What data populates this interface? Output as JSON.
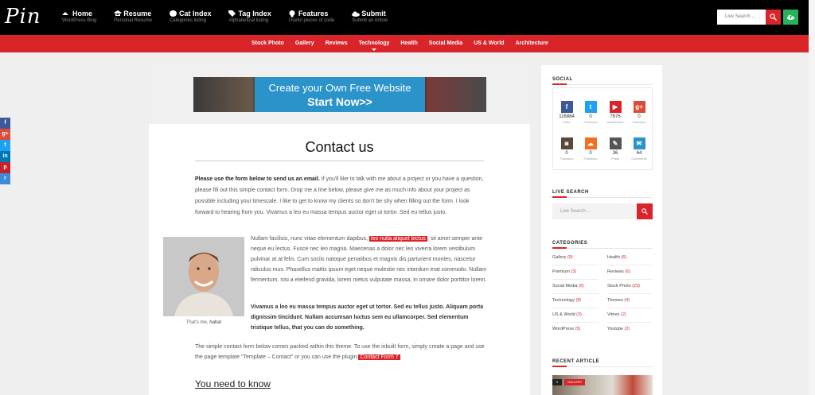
{
  "logo": "Pin",
  "nav": [
    {
      "title": "Home",
      "sub": "WordPress Blog",
      "icon": "home-icon"
    },
    {
      "title": "Resume",
      "sub": "Personal Resume",
      "icon": "graduation-cap-icon"
    },
    {
      "title": "Cat Index",
      "sub": "Categories listing",
      "icon": "globe-icon"
    },
    {
      "title": "Tag Index",
      "sub": "Alphabetical listing",
      "icon": "tags-icon"
    },
    {
      "title": "Features",
      "sub": "Useful pieces of code",
      "icon": "lightbulb-icon"
    },
    {
      "title": "Submit",
      "sub": "Submit an Article",
      "icon": "cloud-upload-icon"
    }
  ],
  "search": {
    "placeholder": "Live Search ..."
  },
  "categories_nav": [
    "Stock Photo",
    "Gallery",
    "Reviews",
    "Technology",
    "Health",
    "Social Media",
    "US & World",
    "Architecture"
  ],
  "social_side": [
    {
      "label": "f",
      "color": "#3b5998",
      "icon": "facebook-icon"
    },
    {
      "label": "g+",
      "color": "#dd4b39",
      "icon": "google-plus-icon"
    },
    {
      "label": "t",
      "color": "#1da1f2",
      "icon": "twitter-icon"
    },
    {
      "label": "in",
      "color": "#0077b5",
      "icon": "linkedin-icon"
    },
    {
      "label": "p",
      "color": "#cb2027",
      "icon": "pinterest-icon"
    },
    {
      "label": "r",
      "color": "#3d8ad8",
      "icon": "reddit-icon"
    }
  ],
  "banner": {
    "line1": "Create your Own Free Website",
    "line2": "Start Now>>"
  },
  "page": {
    "title": "Contact us",
    "intro_bold": "Please use the form below to send us an email.",
    "intro_rest": " If you'll like to talk with me about a project or you have a question, please fill out this simple contact form. Drop me a line below, please give me as much info about your project as possible including your timescale. I like to get to know my clients so don't be shy when filling out the form. I look forward to hearing from you. Vivamus a leo eu massa tempus auctor eget ut tortor. Sed eu tellus justo.",
    "para2_a": "Nullam facilisis, nunc vitae elementum dapibus, ",
    "para2_hl": "leo nulla aliquet lectus",
    "para2_b": ", sit amet semper ante neque eu lectus. Fusce nec leo magna. Maecenas a dolor nec leo viverra lorem vestibulum pulvinar at at felis. Cum sociis natoque penatibus et magnis dis parturient montes, nascetur ridiculus mus. Phasellus mattis ipsum eget neque molestie nec interdum erat commodo. Nullam fermentum, nisi a eleifend gravida, lorem metus vulputate massa, in ornare dolor porttitor lorem.",
    "para3": "Vivamus a leo eu massa tempus auctor eget ut tortor. Sed eu tellus justo. Aliquam porta dignissim tincidunt. Nullam accumsan luctus sem eu ullamcorper. Sed elementum tristique tellus, that you can do something.",
    "para4_a": "The simple contact form below comes packed within this theme. To use the inbuilt form, simply create a page and use the page template \"Template – Contact\" or you can use the plugin ",
    "para4_hl": "Contact Form 7",
    "para4_b": ".",
    "caption_a": "That's me, ",
    "caption_b": "haha!",
    "subhead": "You need to know"
  },
  "sidebar": {
    "social_title": "SOCIAL",
    "social": [
      {
        "num": "116884",
        "label": "Likes",
        "color": "#3b5998",
        "glyph": "f",
        "icon": "facebook-icon"
      },
      {
        "num": "0",
        "label": "Followers",
        "color": "#1da1f2",
        "glyph": "t",
        "icon": "twitter-icon"
      },
      {
        "num": "7676",
        "label": "Subscribers",
        "color": "#d9252a",
        "glyph": "▶",
        "icon": "youtube-icon"
      },
      {
        "num": "0",
        "label": "Followers",
        "color": "#dd4b39",
        "glyph": "g+",
        "icon": "google-plus-icon"
      },
      {
        "num": "0",
        "label": "Followers",
        "color": "#5b4638",
        "glyph": "◙",
        "icon": "instagram-icon"
      },
      {
        "num": "0",
        "label": "Followers",
        "color": "#f26f21",
        "glyph": "☁",
        "icon": "soundcloud-icon"
      },
      {
        "num": "36",
        "label": "Posts",
        "color": "#555555",
        "glyph": "✎",
        "icon": "pencil-icon"
      },
      {
        "num": "64",
        "label": "Comments",
        "color": "#2a93c9",
        "glyph": "✉",
        "icon": "comments-icon"
      }
    ],
    "live_search_title": "LIVE SEARCH",
    "live_search_placeholder": "Live Search ...",
    "categories_title": "CATEGORIES",
    "categories": [
      {
        "name": "Gallery",
        "count": "(9)"
      },
      {
        "name": "Health",
        "count": "(6)"
      },
      {
        "name": "Premium",
        "count": "(3)"
      },
      {
        "name": "Reviews",
        "count": "(6)"
      },
      {
        "name": "Social Media",
        "count": "(5)"
      },
      {
        "name": "Stock Photo",
        "count": "(23)"
      },
      {
        "name": "Technology",
        "count": "(8)"
      },
      {
        "name": "Themes",
        "count": "(4)"
      },
      {
        "name": "US & World",
        "count": "(3)"
      },
      {
        "name": "Vimeo",
        "count": "(2)"
      },
      {
        "name": "WordPress",
        "count": "(5)"
      },
      {
        "name": "Youtube",
        "count": "(2)"
      }
    ],
    "recent_title": "RECENT ARTICLE",
    "recent_tag_count": "0",
    "recent_tag": "GALLERY"
  },
  "colors": {
    "accent": "#d9252a",
    "green": "#27b35a",
    "topbar": "#000000"
  }
}
